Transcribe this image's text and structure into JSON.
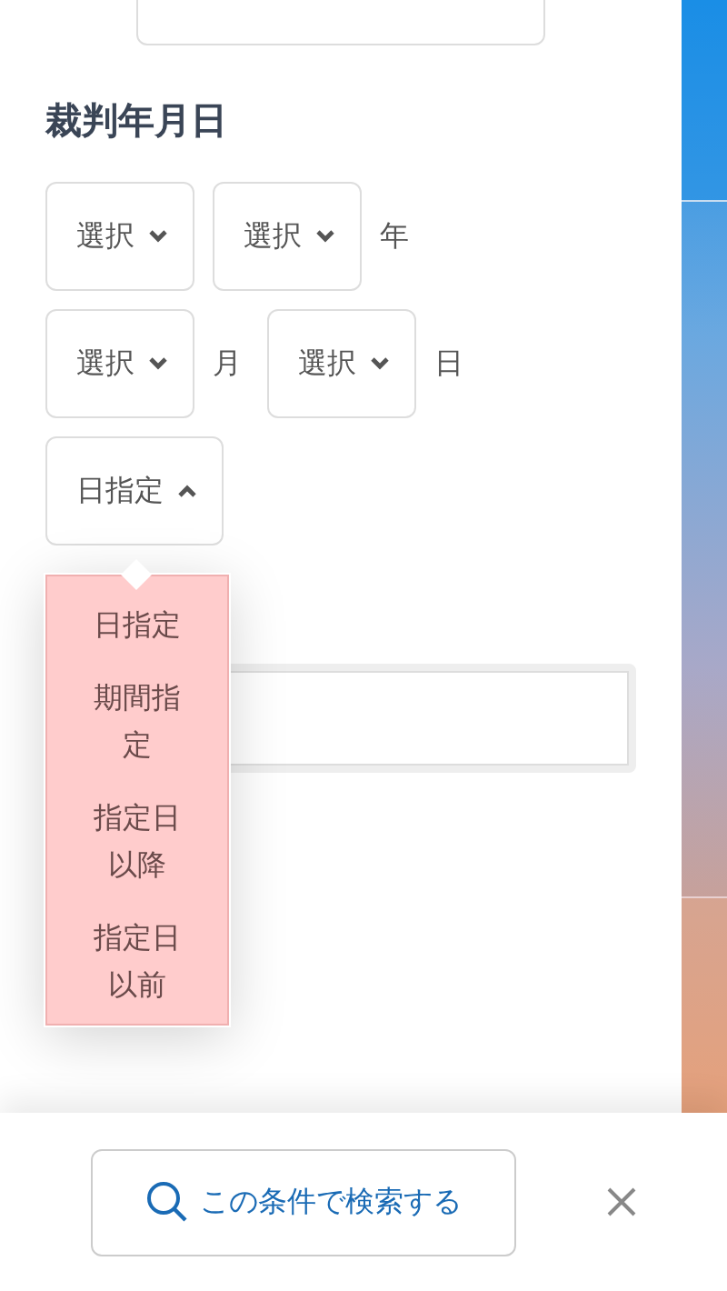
{
  "section_title": "裁判年月日",
  "date_rows": [
    [
      {
        "kind": "select",
        "value": "選択"
      },
      {
        "kind": "select",
        "value": "選択"
      },
      {
        "kind": "unit",
        "text": "年"
      }
    ],
    [
      {
        "kind": "select",
        "value": "選択"
      },
      {
        "kind": "unit",
        "text": "月"
      },
      {
        "kind": "select",
        "value": "選択"
      },
      {
        "kind": "unit",
        "text": "日"
      }
    ]
  ],
  "date_mode": {
    "value": "日指定",
    "expanded": true,
    "options": [
      {
        "label": "日指定"
      },
      {
        "label": "期間指定"
      },
      {
        "label": "指定日以降"
      },
      {
        "label": "指定日以前"
      }
    ]
  },
  "footer": {
    "search_button": "この条件で検索する"
  }
}
